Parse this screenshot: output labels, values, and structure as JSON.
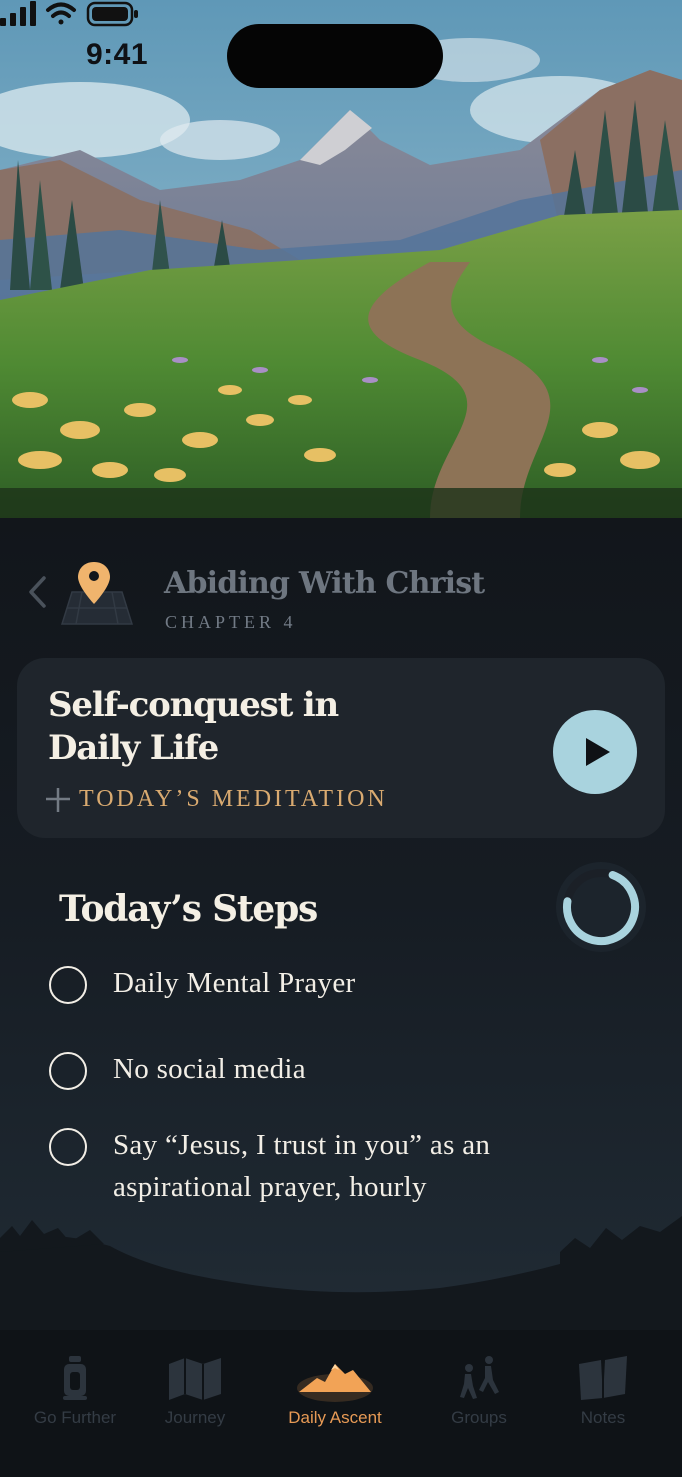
{
  "status_bar": {
    "time": "9:41"
  },
  "journey": {
    "title": "Abiding With Christ",
    "chapter": "CHAPTER 4"
  },
  "meditation": {
    "title_line1": "Self-conquest in",
    "title_line2": "Daily Life",
    "subtitle": "TODAY’S MEDITATION"
  },
  "steps": {
    "title": "Today’s Steps",
    "progress": 0.72,
    "items": [
      {
        "label": "Daily Mental Prayer",
        "checked": false
      },
      {
        "label": "No social media",
        "checked": false
      },
      {
        "label": "Say “Jesus, I trust in you” as an aspirational prayer, hourly",
        "checked": false
      }
    ]
  },
  "tabs": [
    {
      "label": "Go Further",
      "icon": "lantern-icon",
      "active": false
    },
    {
      "label": "Journey",
      "icon": "map-icon",
      "active": false
    },
    {
      "label": "Daily Ascent",
      "icon": "mountain-icon",
      "active": true
    },
    {
      "label": "Groups",
      "icon": "hikers-icon",
      "active": false
    },
    {
      "label": "Notes",
      "icon": "book-icon",
      "active": false
    }
  ],
  "colors": {
    "accent": "#d9aa70",
    "active_tab": "#e79a55",
    "play_button": "#a9d3de",
    "background": "#13171d",
    "card": "#1f252c"
  }
}
